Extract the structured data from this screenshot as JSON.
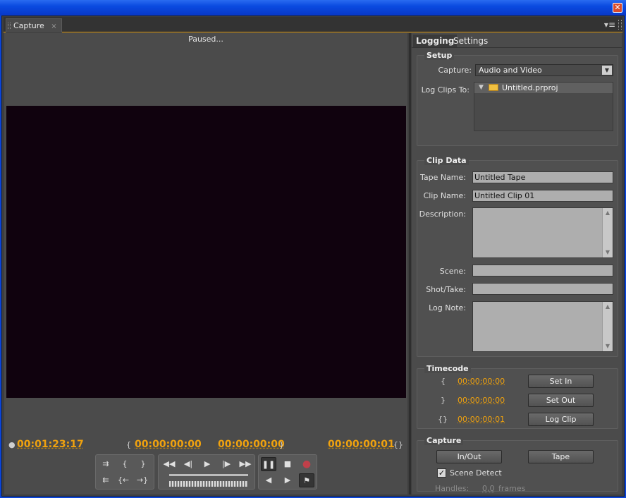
{
  "window": {
    "close_glyph": "✕"
  },
  "panel": {
    "tab_label": "Capture",
    "tab_close": "×",
    "menu_glyph": "▾≡"
  },
  "monitor": {
    "status": "Paused...",
    "current_tc": "00:01:23:17",
    "in_tc": "00:00:00:00",
    "out_tc": "00:00:00:00",
    "duration_tc": "00:00:00:01",
    "icons": {
      "current": "●",
      "in": "{",
      "out": "}",
      "dur": "{}"
    }
  },
  "transport": {
    "set_in": "{",
    "set_out": "}",
    "goto_in": "{←",
    "goto_out": "→}",
    "rewind": "◀◀",
    "step_back": "◀|",
    "play": "▶",
    "step_fwd": "|▶",
    "ffwd": "▶▶",
    "pause": "❚❚",
    "stop": "■",
    "record": "●",
    "shuttle_left": "◀",
    "shuttle_right": "▶",
    "scene_detect": "⚑",
    "tape_in": "⇉",
    "tape_out": "⇇"
  },
  "tabs": {
    "logging": "Logging",
    "settings": "Settings"
  },
  "setup": {
    "title": "Setup",
    "capture_label": "Capture:",
    "capture_value": "Audio and Video",
    "log_clips_label": "Log Clips To:",
    "project": "Untitled.prproj"
  },
  "clip_data": {
    "title": "Clip Data",
    "tape_name_label": "Tape Name:",
    "tape_name_value": "Untitled Tape",
    "clip_name_label": "Clip Name:",
    "clip_name_value": "Untitled Clip 01",
    "description_label": "Description:",
    "scene_label": "Scene:",
    "shot_take_label": "Shot/Take:",
    "log_note_label": "Log Note:"
  },
  "timecode": {
    "title": "Timecode",
    "in_icon": "{",
    "out_icon": "}",
    "dur_icon": "{}",
    "in_value": "00:00:00:00",
    "out_value": "00:00:00:00",
    "dur_value": "00:00:00:01",
    "set_in": "Set In",
    "set_out": "Set Out",
    "log_clip": "Log Clip"
  },
  "capture": {
    "title": "Capture",
    "in_out": "In/Out",
    "tape": "Tape",
    "scene_detect": "Scene Detect",
    "scene_detect_checked": true,
    "handles_label": "Handles:",
    "handles_value": "0,0",
    "frames_label": "frames"
  }
}
